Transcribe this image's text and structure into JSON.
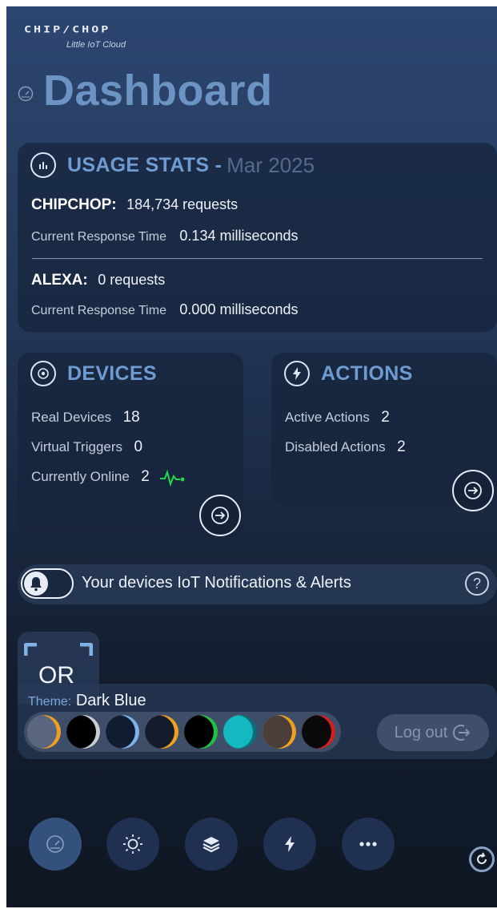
{
  "brand": {
    "logo": "CHIP/CHOP",
    "subtitle": "Little IoT Cloud"
  },
  "page": {
    "title": "Dashboard"
  },
  "usage": {
    "title": "USAGE STATS -",
    "period": "Mar 2025",
    "chipchop_label": "CHIPCHOP:",
    "chipchop_value": "184,734 requests",
    "chipchop_rt_label": "Current Response Time",
    "chipchop_rt_value": "0.134 milliseconds",
    "alexa_label": "ALEXA:",
    "alexa_value": "0 requests",
    "alexa_rt_label": "Current Response Time",
    "alexa_rt_value": "0.000 milliseconds"
  },
  "devices": {
    "title": "DEVICES",
    "real_label": "Real Devices",
    "real_value": "18",
    "virtual_label": "Virtual Triggers",
    "virtual_value": "0",
    "online_label": "Currently Online",
    "online_value": "2"
  },
  "actions": {
    "title": "ACTIONS",
    "active_label": "Active Actions",
    "active_value": "2",
    "disabled_label": "Disabled Actions",
    "disabled_value": "2"
  },
  "notifications": {
    "text": "Your devices IoT Notifications & Alerts",
    "enabled": false
  },
  "or_tab": {
    "label": "OR"
  },
  "theme": {
    "label": "Theme:",
    "value": "Dark Blue",
    "swatches": [
      {
        "name": "dark-blue",
        "base": "#5a6580",
        "accent": "#f0a020"
      },
      {
        "name": "black-white",
        "base": "#000000",
        "accent": "#c8ccd4"
      },
      {
        "name": "navy-lightblue",
        "base": "#101c30",
        "accent": "#7fb3e8"
      },
      {
        "name": "navy-orange",
        "base": "#141c2c",
        "accent": "#f0a020"
      },
      {
        "name": "black-green",
        "base": "#000000",
        "accent": "#20c040"
      },
      {
        "name": "teal",
        "base": "#14b8c0",
        "accent": "#0d6d78"
      },
      {
        "name": "brown-orange",
        "base": "#4a3e38",
        "accent": "#f0a020"
      },
      {
        "name": "black-red",
        "base": "#0a0a0a",
        "accent": "#d02020"
      }
    ],
    "logout_label": "Log out"
  },
  "nav": {
    "items": [
      {
        "icon": "dashboard-gauge-icon",
        "active": true
      },
      {
        "icon": "sun-icon",
        "active": false
      },
      {
        "icon": "layers-icon",
        "active": false
      },
      {
        "icon": "lightning-icon",
        "active": false
      },
      {
        "icon": "more-dots-icon",
        "active": false
      }
    ]
  },
  "colors": {
    "accent": "#6f9bd1",
    "online_pulse": "#22d84a"
  }
}
